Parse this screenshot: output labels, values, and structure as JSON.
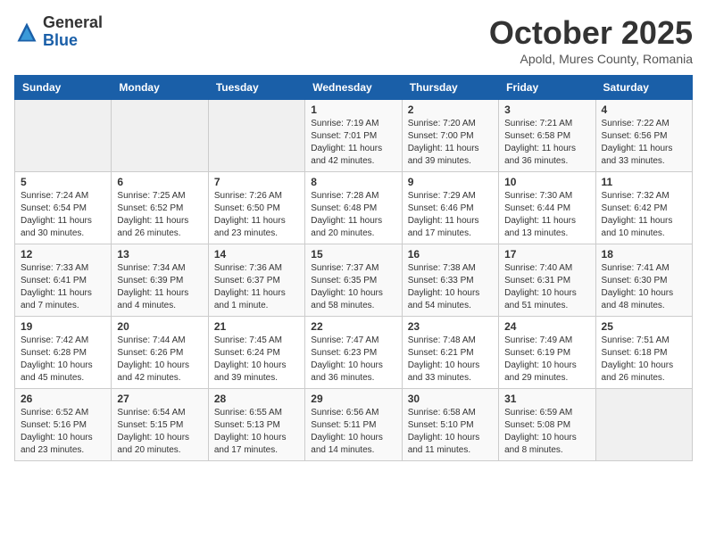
{
  "logo": {
    "general": "General",
    "blue": "Blue"
  },
  "header": {
    "month_title": "October 2025",
    "location": "Apold, Mures County, Romania"
  },
  "weekdays": [
    "Sunday",
    "Monday",
    "Tuesday",
    "Wednesday",
    "Thursday",
    "Friday",
    "Saturday"
  ],
  "weeks": [
    [
      {
        "day": "",
        "info": ""
      },
      {
        "day": "",
        "info": ""
      },
      {
        "day": "",
        "info": ""
      },
      {
        "day": "1",
        "info": "Sunrise: 7:19 AM\nSunset: 7:01 PM\nDaylight: 11 hours and 42 minutes."
      },
      {
        "day": "2",
        "info": "Sunrise: 7:20 AM\nSunset: 7:00 PM\nDaylight: 11 hours and 39 minutes."
      },
      {
        "day": "3",
        "info": "Sunrise: 7:21 AM\nSunset: 6:58 PM\nDaylight: 11 hours and 36 minutes."
      },
      {
        "day": "4",
        "info": "Sunrise: 7:22 AM\nSunset: 6:56 PM\nDaylight: 11 hours and 33 minutes."
      }
    ],
    [
      {
        "day": "5",
        "info": "Sunrise: 7:24 AM\nSunset: 6:54 PM\nDaylight: 11 hours and 30 minutes."
      },
      {
        "day": "6",
        "info": "Sunrise: 7:25 AM\nSunset: 6:52 PM\nDaylight: 11 hours and 26 minutes."
      },
      {
        "day": "7",
        "info": "Sunrise: 7:26 AM\nSunset: 6:50 PM\nDaylight: 11 hours and 23 minutes."
      },
      {
        "day": "8",
        "info": "Sunrise: 7:28 AM\nSunset: 6:48 PM\nDaylight: 11 hours and 20 minutes."
      },
      {
        "day": "9",
        "info": "Sunrise: 7:29 AM\nSunset: 6:46 PM\nDaylight: 11 hours and 17 minutes."
      },
      {
        "day": "10",
        "info": "Sunrise: 7:30 AM\nSunset: 6:44 PM\nDaylight: 11 hours and 13 minutes."
      },
      {
        "day": "11",
        "info": "Sunrise: 7:32 AM\nSunset: 6:42 PM\nDaylight: 11 hours and 10 minutes."
      }
    ],
    [
      {
        "day": "12",
        "info": "Sunrise: 7:33 AM\nSunset: 6:41 PM\nDaylight: 11 hours and 7 minutes."
      },
      {
        "day": "13",
        "info": "Sunrise: 7:34 AM\nSunset: 6:39 PM\nDaylight: 11 hours and 4 minutes."
      },
      {
        "day": "14",
        "info": "Sunrise: 7:36 AM\nSunset: 6:37 PM\nDaylight: 11 hours and 1 minute."
      },
      {
        "day": "15",
        "info": "Sunrise: 7:37 AM\nSunset: 6:35 PM\nDaylight: 10 hours and 58 minutes."
      },
      {
        "day": "16",
        "info": "Sunrise: 7:38 AM\nSunset: 6:33 PM\nDaylight: 10 hours and 54 minutes."
      },
      {
        "day": "17",
        "info": "Sunrise: 7:40 AM\nSunset: 6:31 PM\nDaylight: 10 hours and 51 minutes."
      },
      {
        "day": "18",
        "info": "Sunrise: 7:41 AM\nSunset: 6:30 PM\nDaylight: 10 hours and 48 minutes."
      }
    ],
    [
      {
        "day": "19",
        "info": "Sunrise: 7:42 AM\nSunset: 6:28 PM\nDaylight: 10 hours and 45 minutes."
      },
      {
        "day": "20",
        "info": "Sunrise: 7:44 AM\nSunset: 6:26 PM\nDaylight: 10 hours and 42 minutes."
      },
      {
        "day": "21",
        "info": "Sunrise: 7:45 AM\nSunset: 6:24 PM\nDaylight: 10 hours and 39 minutes."
      },
      {
        "day": "22",
        "info": "Sunrise: 7:47 AM\nSunset: 6:23 PM\nDaylight: 10 hours and 36 minutes."
      },
      {
        "day": "23",
        "info": "Sunrise: 7:48 AM\nSunset: 6:21 PM\nDaylight: 10 hours and 33 minutes."
      },
      {
        "day": "24",
        "info": "Sunrise: 7:49 AM\nSunset: 6:19 PM\nDaylight: 10 hours and 29 minutes."
      },
      {
        "day": "25",
        "info": "Sunrise: 7:51 AM\nSunset: 6:18 PM\nDaylight: 10 hours and 26 minutes."
      }
    ],
    [
      {
        "day": "26",
        "info": "Sunrise: 6:52 AM\nSunset: 5:16 PM\nDaylight: 10 hours and 23 minutes."
      },
      {
        "day": "27",
        "info": "Sunrise: 6:54 AM\nSunset: 5:15 PM\nDaylight: 10 hours and 20 minutes."
      },
      {
        "day": "28",
        "info": "Sunrise: 6:55 AM\nSunset: 5:13 PM\nDaylight: 10 hours and 17 minutes."
      },
      {
        "day": "29",
        "info": "Sunrise: 6:56 AM\nSunset: 5:11 PM\nDaylight: 10 hours and 14 minutes."
      },
      {
        "day": "30",
        "info": "Sunrise: 6:58 AM\nSunset: 5:10 PM\nDaylight: 10 hours and 11 minutes."
      },
      {
        "day": "31",
        "info": "Sunrise: 6:59 AM\nSunset: 5:08 PM\nDaylight: 10 hours and 8 minutes."
      },
      {
        "day": "",
        "info": ""
      }
    ]
  ]
}
